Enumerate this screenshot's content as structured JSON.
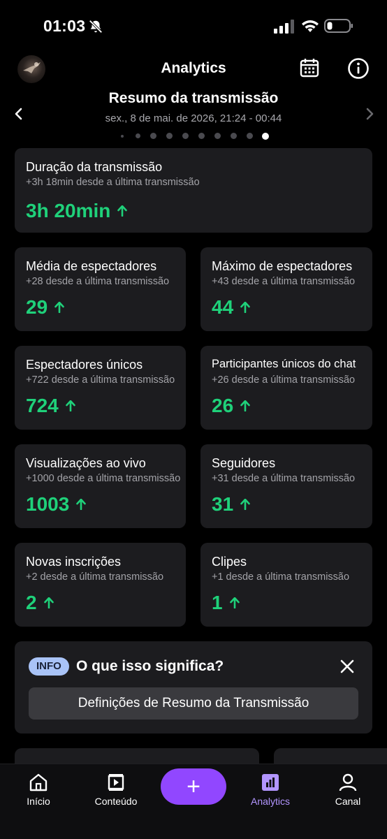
{
  "status_bar": {
    "time": "01:03"
  },
  "header": {
    "title": "Analytics"
  },
  "summary": {
    "title": "Resumo da transmissão",
    "date_range": "sex., 8 de mai. de 2026, 21:24 - 00:44",
    "page_count": 10,
    "active_page": 10
  },
  "metrics": {
    "duration": {
      "title": "Duração da transmissão",
      "delta": "+3h 18min desde a última transmissão",
      "value": "3h 20min"
    },
    "avg_viewers": {
      "title": "Média de espectadores",
      "delta": "+28 desde a última transmissão",
      "value": "29"
    },
    "max_viewers": {
      "title": "Máximo de espectadores",
      "delta": "+43 desde a última transmissão",
      "value": "44"
    },
    "unique_viewers": {
      "title": "Espectadores únicos",
      "delta": "+722 desde a última transmissão",
      "value": "724"
    },
    "unique_chatters": {
      "title": "Participantes únicos do chat",
      "delta": "+26 desde a última transmissão",
      "value": "26"
    },
    "live_views": {
      "title": "Visualizações ao vivo",
      "delta": "+1000 desde a última transmissão",
      "value": "1003"
    },
    "followers": {
      "title": "Seguidores",
      "delta": "+31 desde a última transmissão",
      "value": "31"
    },
    "new_subs": {
      "title": "Novas inscrições",
      "delta": "+2 desde a última transmissão",
      "value": "2"
    },
    "clips": {
      "title": "Clipes",
      "delta": "+1 desde a última transmissão",
      "value": "1"
    }
  },
  "info_panel": {
    "badge": "INFO",
    "question": "O que isso significa?",
    "button_label": "Definições de Resumo da Transmissão"
  },
  "tabbar": {
    "home": "Início",
    "content": "Conteúdo",
    "analytics": "Analytics",
    "channel": "Canal",
    "active": "analytics"
  },
  "colors": {
    "accent_green": "#1fd17a",
    "accent_purple": "#9147ff",
    "active_tab": "#b295ff",
    "card_bg": "#1c1c1f"
  }
}
